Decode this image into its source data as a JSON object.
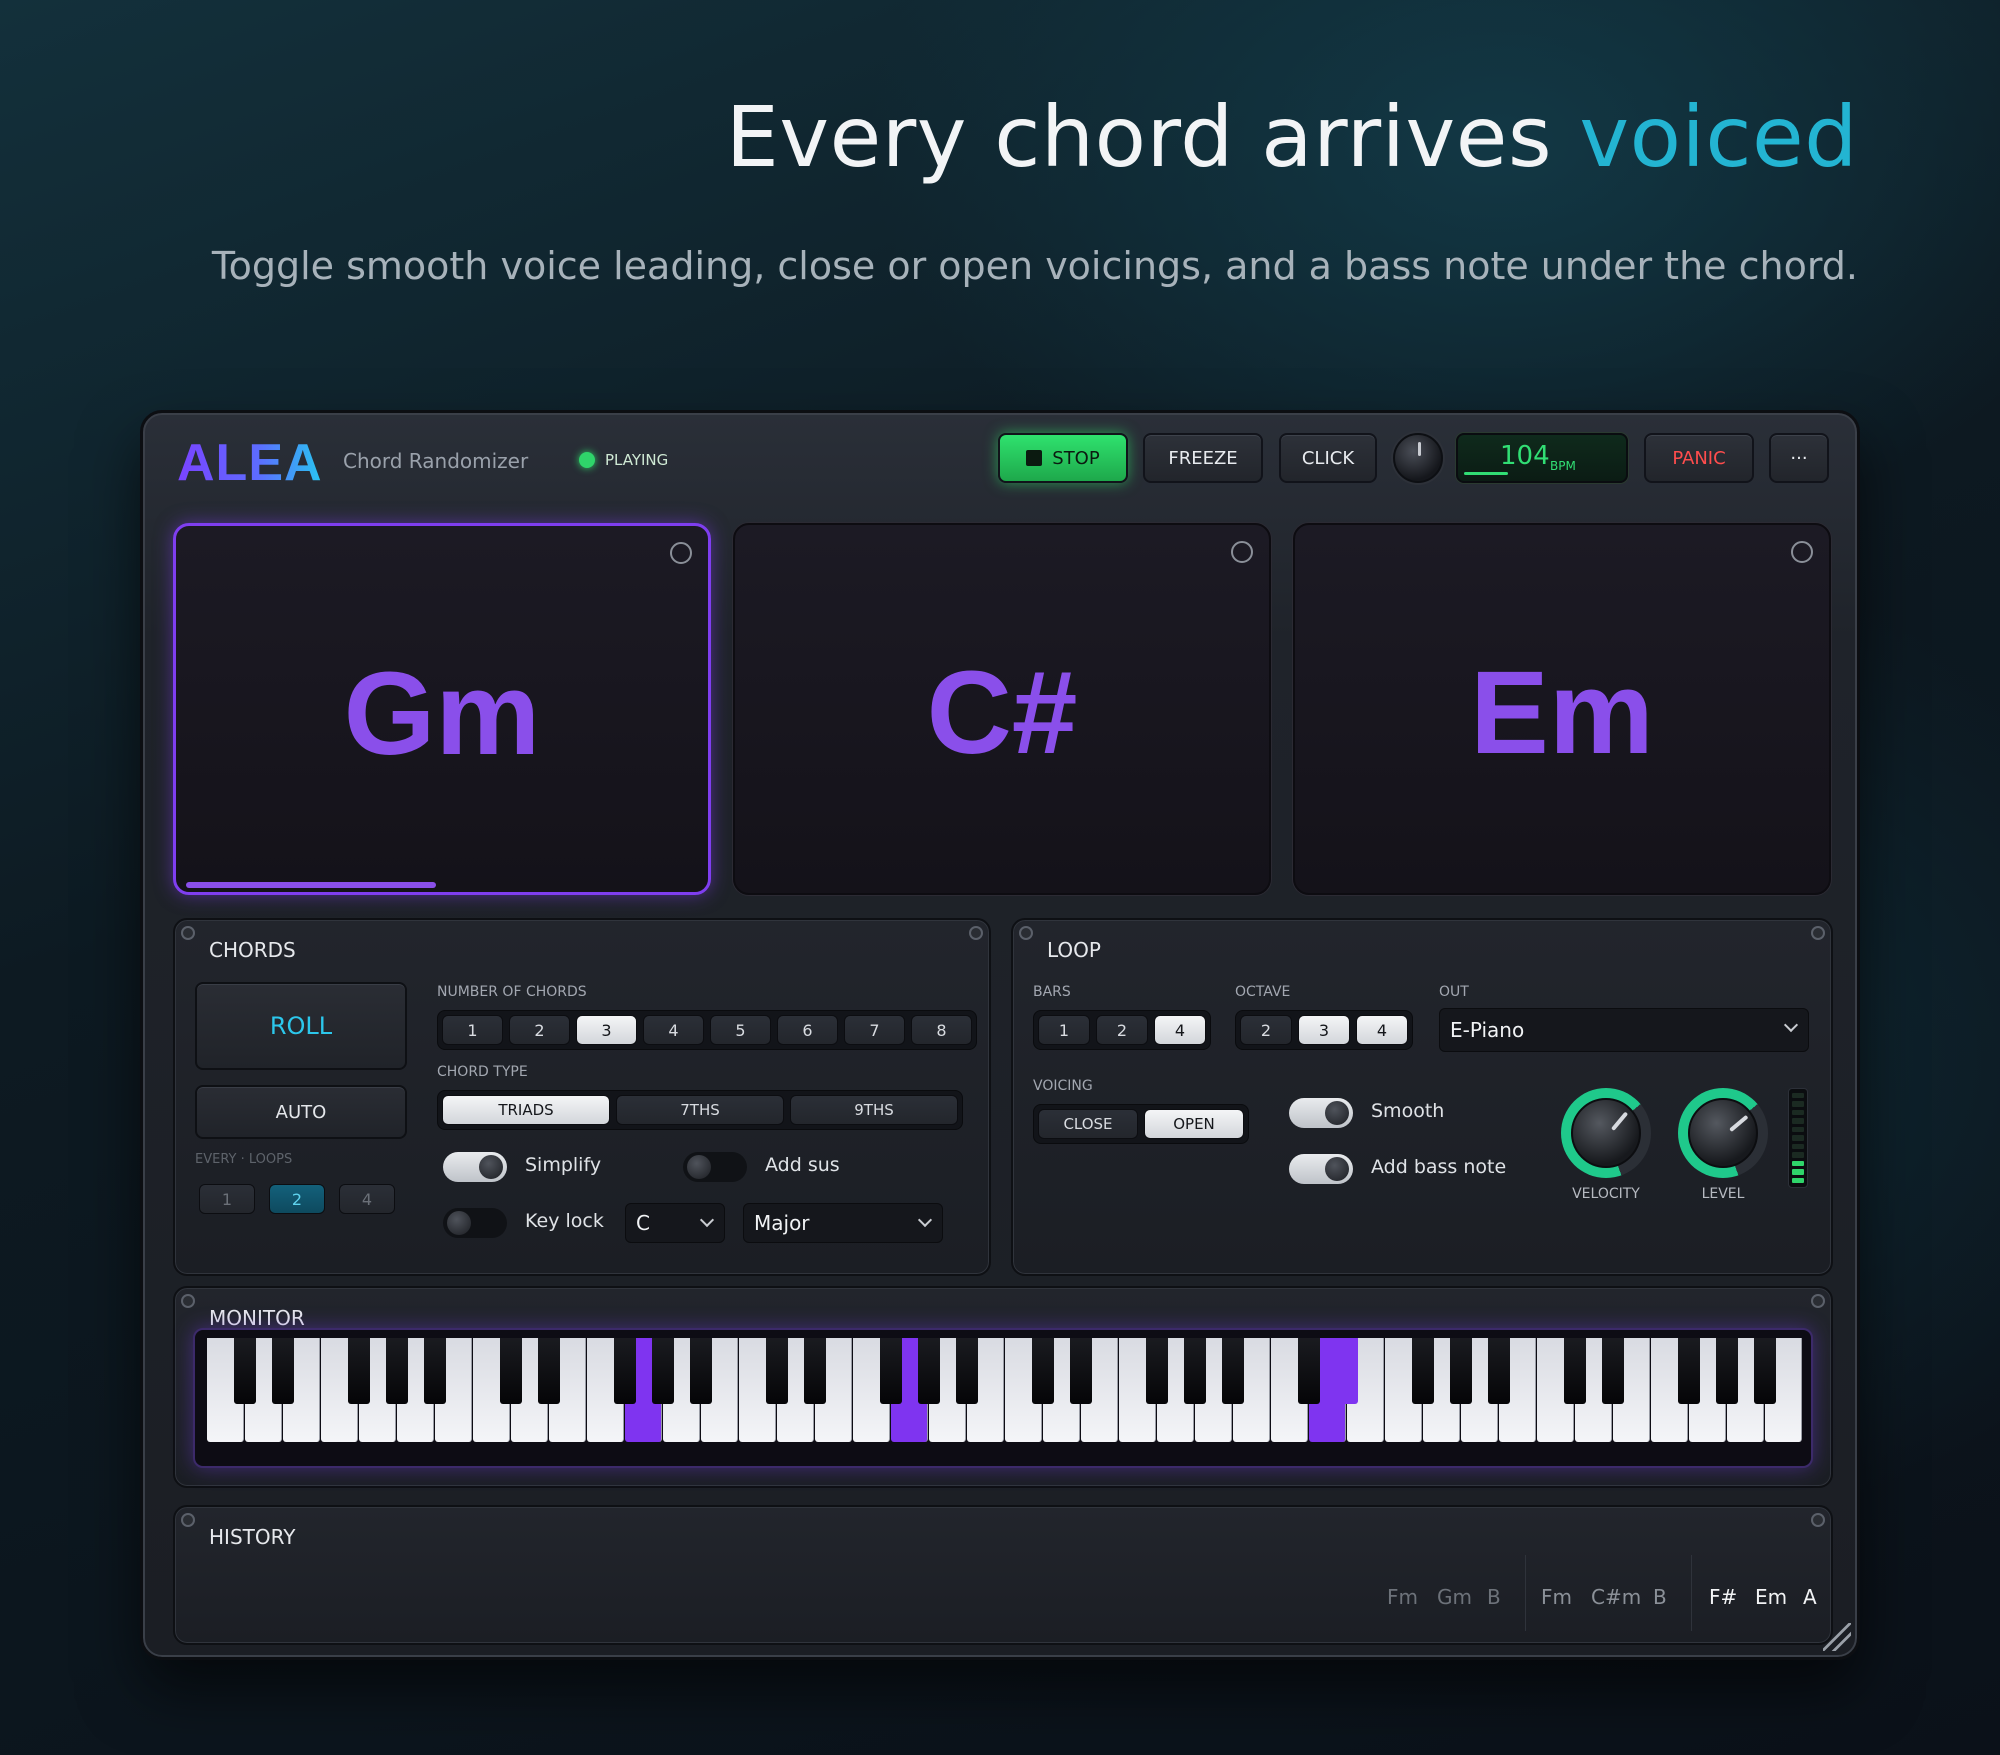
{
  "headline": {
    "main": "Every chord arrives ",
    "accent": "voiced"
  },
  "subline": "Toggle smooth voice leading, close or open voicings, and a bass note under the chord.",
  "app": {
    "logo": "ALEA",
    "subtitle": "Chord Randomizer",
    "status": "PLAYING"
  },
  "transport": {
    "stop": "STOP",
    "freeze": "FREEZE",
    "click": "CLICK",
    "bpm_value": "104",
    "bpm_unit": "BPM",
    "panic": "PANIC",
    "more": "···"
  },
  "cards": [
    {
      "chord": "Gm",
      "active": true,
      "progress": 0.47
    },
    {
      "chord": "C#",
      "active": false
    },
    {
      "chord": "Em",
      "active": false
    }
  ],
  "chords_panel": {
    "title": "CHORDS",
    "roll": "ROLL",
    "auto": "AUTO",
    "every_loops_label": "EVERY · LOOPS",
    "every_loops": [
      "1",
      "2",
      "4"
    ],
    "every_loops_selected": "2",
    "number_label": "NUMBER OF CHORDS",
    "numbers": [
      "1",
      "2",
      "3",
      "4",
      "5",
      "6",
      "7",
      "8"
    ],
    "number_selected": "3",
    "type_label": "CHORD TYPE",
    "types": [
      "TRIADS",
      "7THS",
      "9THS"
    ],
    "type_selected": "TRIADS",
    "simplify": {
      "label": "Simplify",
      "on": true
    },
    "add_sus": {
      "label": "Add sus",
      "on": false
    },
    "key_lock": {
      "label": "Key lock",
      "on": false
    },
    "key": "C",
    "scale": "Major"
  },
  "loop_panel": {
    "title": "LOOP",
    "bars_label": "BARS",
    "bars": [
      "1",
      "2",
      "4"
    ],
    "bars_selected": "4",
    "octave_label": "OCTAVE",
    "octaves": [
      "2",
      "3",
      "4"
    ],
    "octave_selected": [
      "3",
      "4"
    ],
    "out_label": "OUT",
    "out_value": "E-Piano",
    "voicing_label": "VOICING",
    "voicings": [
      "CLOSE",
      "OPEN"
    ],
    "voicing_selected": "OPEN",
    "smooth": {
      "label": "Smooth",
      "on": true
    },
    "add_bass": {
      "label": "Add bass note",
      "on": true
    },
    "velocity_label": "VELOCITY",
    "level_label": "LEVEL"
  },
  "monitor": {
    "title": "MONITOR"
  },
  "history": {
    "title": "HISTORY",
    "groups": [
      [
        "Fm",
        "Gm",
        "B"
      ],
      [
        "Fm",
        "C#m",
        "B"
      ],
      [
        "F#",
        "Em",
        "A"
      ]
    ]
  },
  "colors": {
    "accent": "#23b4d2",
    "chord": "#8a4fea",
    "green": "#2fd46a",
    "panic": "#ff4d4d",
    "teal_knob": "#1fc98b"
  }
}
